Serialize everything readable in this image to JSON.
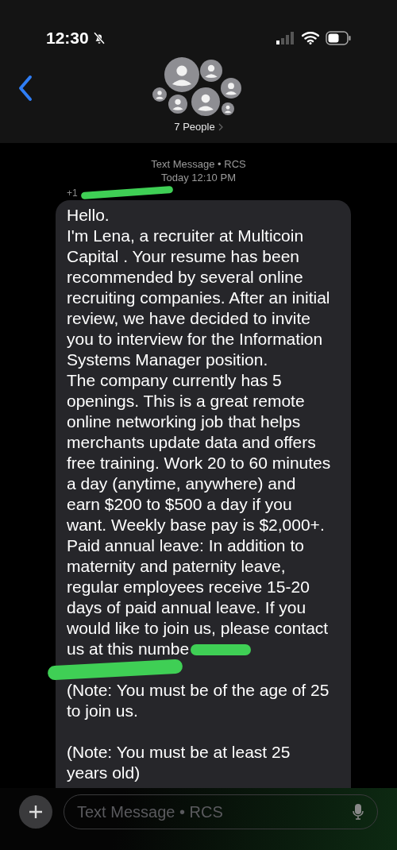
{
  "status_bar": {
    "time": "12:30",
    "silent": true
  },
  "header": {
    "title": "7 People"
  },
  "thread": {
    "service": "Text Message • RCS",
    "timestamp": "Today 12:10 PM",
    "sender": "+1"
  },
  "message": {
    "paragraphs": [
      {
        "text": "Hello."
      },
      {
        "text": "I'm Lena, a recruiter at Multicoin Capital . Your resume has been recommended by several online recruiting companies. After an initial review, we have decided to invite you to interview for the Information Systems Manager position."
      },
      {
        "text": "The company currently has 5 openings. This is a great remote online networking job that helps merchants update data and offers free training. Work 20 to 60 minutes a day (anytime, anywhere) and earn $200 to $500 a day if you want. Weekly base pay is $2,000+. Paid annual leave: In addition to maternity and paternity leave, regular employees receive 15-20 days of paid annual leave. If you would like to join us, please contact us at this numbe",
        "redacted_after": true,
        "after": "(Note: You must be of the age of 25 to join us."
      },
      {
        "kind": "blank"
      },
      {
        "text": "(Note: You must be at least 25 years old)"
      }
    ]
  },
  "composer": {
    "placeholder": "Text Message • RCS"
  }
}
